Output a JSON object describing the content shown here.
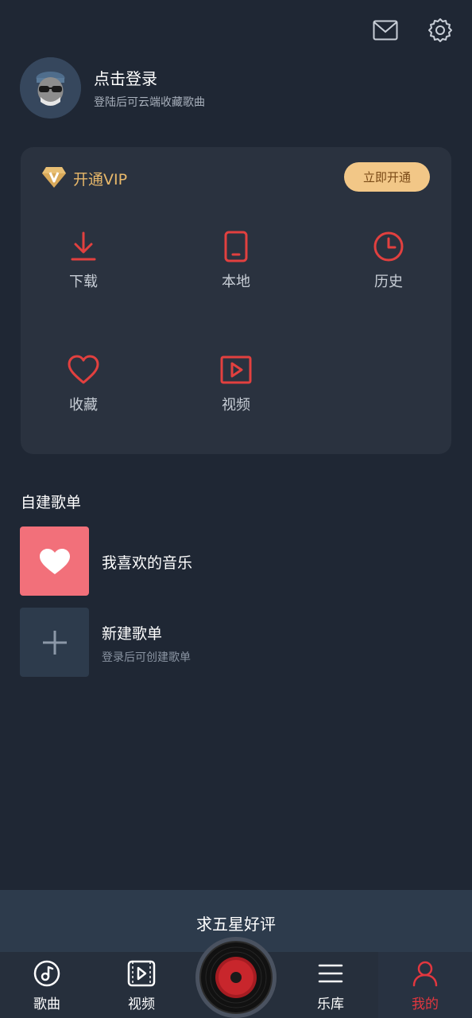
{
  "header": {
    "mail_icon": "mail-icon",
    "settings_icon": "gear-icon"
  },
  "profile": {
    "title": "点击登录",
    "subtitle": "登陆后可云端收藏歌曲"
  },
  "vip": {
    "label": "开通VIP",
    "button": "立即开通",
    "accent": "#e8b86a"
  },
  "features": [
    {
      "label": "下载",
      "icon": "download-icon"
    },
    {
      "label": "本地",
      "icon": "phone-icon"
    },
    {
      "label": "历史",
      "icon": "clock-icon"
    },
    {
      "label": "收藏",
      "icon": "heart-icon"
    },
    {
      "label": "视频",
      "icon": "video-icon"
    }
  ],
  "playlists": {
    "section_title": "自建歌单",
    "items": [
      {
        "title": "我喜欢的音乐",
        "subtitle": ""
      },
      {
        "title": "新建歌单",
        "subtitle": "登录后可创建歌单"
      }
    ]
  },
  "rating_banner": "求五星好评",
  "tabs": [
    {
      "label": "歌曲",
      "icon": "music-note-icon",
      "active": false
    },
    {
      "label": "视频",
      "icon": "video-icon",
      "active": false
    },
    {
      "label": "乐库",
      "icon": "menu-icon",
      "active": false
    },
    {
      "label": "我的",
      "icon": "user-icon",
      "active": true
    }
  ],
  "colors": {
    "background": "#1f2734",
    "card": "#2a323f",
    "red": "#e2373f",
    "like_cover": "#f2707a"
  }
}
